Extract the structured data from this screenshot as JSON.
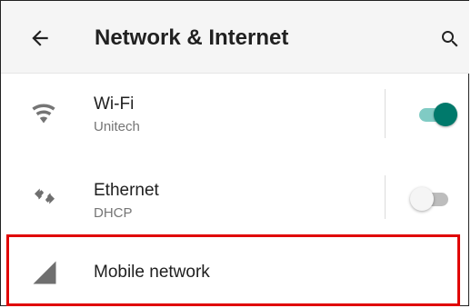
{
  "appbar": {
    "title": "Network & Internet",
    "back_icon": "arrow-back-icon",
    "search_icon": "search-icon"
  },
  "settings": [
    {
      "id": "wifi",
      "label": "Wi-Fi",
      "summary": "Unitech",
      "icon": "wifi-icon",
      "toggle_on": true
    },
    {
      "id": "ethernet",
      "label": "Ethernet",
      "summary": "DHCP",
      "icon": "ethernet-icon",
      "toggle_on": false
    },
    {
      "id": "mobile",
      "label": "Mobile network",
      "icon": "signal-icon"
    }
  ],
  "colors": {
    "accent": "#00796b",
    "accent_track": "#80cbc4",
    "highlight": "#e00000"
  }
}
